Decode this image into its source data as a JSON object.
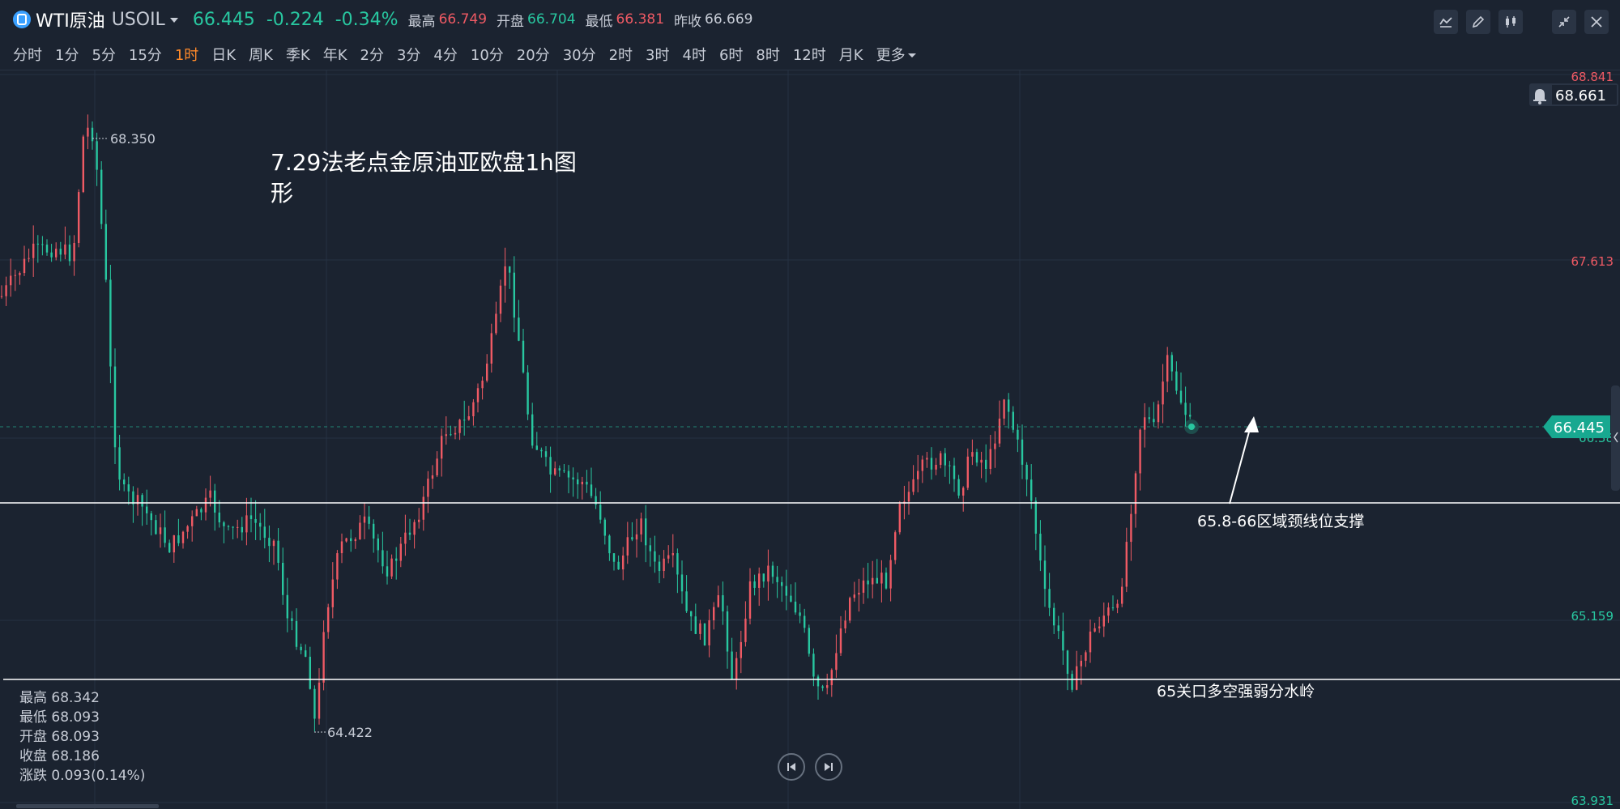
{
  "header": {
    "symbol_name": "WTI原油",
    "symbol_code": "USOIL",
    "last_price": "66.445",
    "change": "-0.224",
    "change_pct": "-0.34%",
    "stats": [
      {
        "label": "最高",
        "value": "66.749",
        "color": "#ef5a64"
      },
      {
        "label": "开盘",
        "value": "66.704",
        "color": "#28c7a0"
      },
      {
        "label": "最低",
        "value": "66.381",
        "color": "#ef5a64"
      },
      {
        "label": "昨收",
        "value": "66.669",
        "color": "#c7ccd6"
      }
    ],
    "toolbar_icons": [
      "indicator-icon",
      "draw-icon",
      "candle-type-icon",
      "collapse-icon",
      "close-icon"
    ]
  },
  "periods": {
    "items": [
      "分时",
      "1分",
      "5分",
      "15分",
      "1时",
      "日K",
      "周K",
      "季K",
      "年K",
      "2分",
      "3分",
      "4分",
      "10分",
      "20分",
      "30分",
      "2时",
      "3时",
      "4时",
      "6时",
      "8时",
      "12时",
      "月K",
      "更多"
    ],
    "active": "1时"
  },
  "chart": {
    "price_axis": [
      {
        "label": "68.841",
        "color": "#ef5a64"
      },
      {
        "label": "67.613",
        "color": "#ef5a64"
      },
      {
        "label": "65.159",
        "color": "#28c7a0"
      },
      {
        "label": "63.931",
        "color": "#28c7a0"
      }
    ],
    "alert_price": "68.661",
    "current_price_tag": "66.445",
    "hidden_label": "66.38",
    "max_marker": "68.350",
    "min_marker": "64.422",
    "annotation_title_line1": "7.29法老点金原油亚欧盘1h图",
    "annotation_title_line2": "形",
    "label_support": "65.8-66区域颈线位支撑",
    "label_watershed": "65关口多空强弱分水岭",
    "ohlc_info": {
      "high": "最高 68.342",
      "low": "最低 68.093",
      "open": "开盘 68.093",
      "close": "收盘 68.186",
      "change": "涨跌 0.093(0.14%)"
    },
    "colors": {
      "up": "#ef5a64",
      "down": "#28c7a0",
      "bg": "#1b2330",
      "grid": "#263142"
    }
  }
}
